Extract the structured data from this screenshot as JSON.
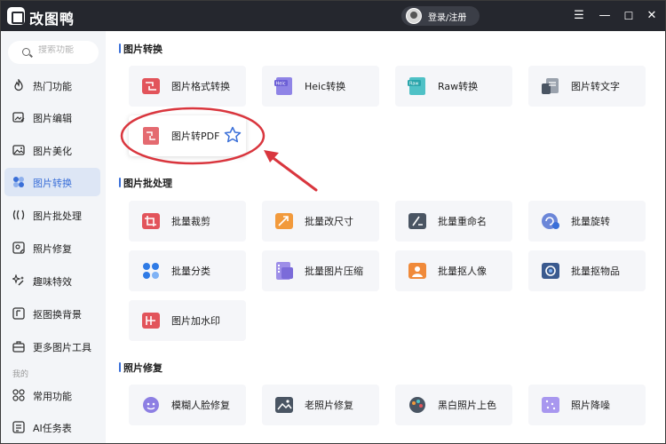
{
  "app": {
    "title": "改图鸭",
    "login_label": "登录/注册"
  },
  "window_controls": {
    "menu": "☰",
    "minimize": "—",
    "maximize": "☐",
    "close": "✕"
  },
  "search": {
    "placeholder": "搜索功能"
  },
  "sidebar": {
    "items": [
      {
        "label": "热门功能",
        "icon": "flame-icon"
      },
      {
        "label": "图片编辑",
        "icon": "image-edit-icon"
      },
      {
        "label": "图片美化",
        "icon": "image-beautify-icon"
      },
      {
        "label": "图片转换",
        "icon": "image-convert-icon",
        "active": true
      },
      {
        "label": "图片批处理",
        "icon": "batch-icon"
      },
      {
        "label": "照片修复",
        "icon": "photo-repair-icon"
      },
      {
        "label": "趣味特效",
        "icon": "sparkle-icon"
      },
      {
        "label": "抠图换背景",
        "icon": "cutout-icon"
      },
      {
        "label": "更多图片工具",
        "icon": "toolbox-icon"
      }
    ],
    "section_mine": "我的",
    "mine_items": [
      {
        "label": "常用功能",
        "icon": "grid-icon"
      },
      {
        "label": "AI任务表",
        "icon": "task-list-icon"
      }
    ]
  },
  "sections": [
    {
      "title": "图片转换",
      "cards": [
        {
          "label": "图片格式转换",
          "icon": "format-convert-icon"
        },
        {
          "label": "Heic转换",
          "icon": "heic-icon",
          "badge": "Heic"
        },
        {
          "label": "Raw转换",
          "icon": "raw-icon",
          "badge": "Raw"
        },
        {
          "label": "图片转文字",
          "icon": "image-to-text-icon"
        },
        {
          "label": "图片转PDF",
          "icon": "image-to-pdf-icon",
          "highlighted": true,
          "star": "star-icon"
        }
      ]
    },
    {
      "title": "图片批处理",
      "cards": [
        {
          "label": "批量裁剪",
          "icon": "batch-crop-icon"
        },
        {
          "label": "批量改尺寸",
          "icon": "batch-resize-icon"
        },
        {
          "label": "批量重命名",
          "icon": "batch-rename-icon"
        },
        {
          "label": "批量旋转",
          "icon": "batch-rotate-icon"
        },
        {
          "label": "批量分类",
          "icon": "batch-classify-icon"
        },
        {
          "label": "批量图片压缩",
          "icon": "batch-compress-icon"
        },
        {
          "label": "批量抠人像",
          "icon": "batch-portrait-icon"
        },
        {
          "label": "批量抠物品",
          "icon": "batch-object-icon"
        },
        {
          "label": "图片加水印",
          "icon": "watermark-icon"
        }
      ]
    },
    {
      "title": "照片修复",
      "cards": [
        {
          "label": "模糊人脸修复",
          "icon": "face-repair-icon"
        },
        {
          "label": "老照片修复",
          "icon": "old-photo-icon"
        },
        {
          "label": "黑白照片上色",
          "icon": "colorize-icon"
        },
        {
          "label": "照片降噪",
          "icon": "denoise-icon"
        }
      ]
    }
  ],
  "colors": {
    "titlebar": "#25272e",
    "sidebar_bg": "#f3f5f8",
    "active_nav_bg": "#dde6f5",
    "accent": "#3a6fd8",
    "card_bg": "#f5f6f9",
    "annotation_red": "#d9363e"
  }
}
